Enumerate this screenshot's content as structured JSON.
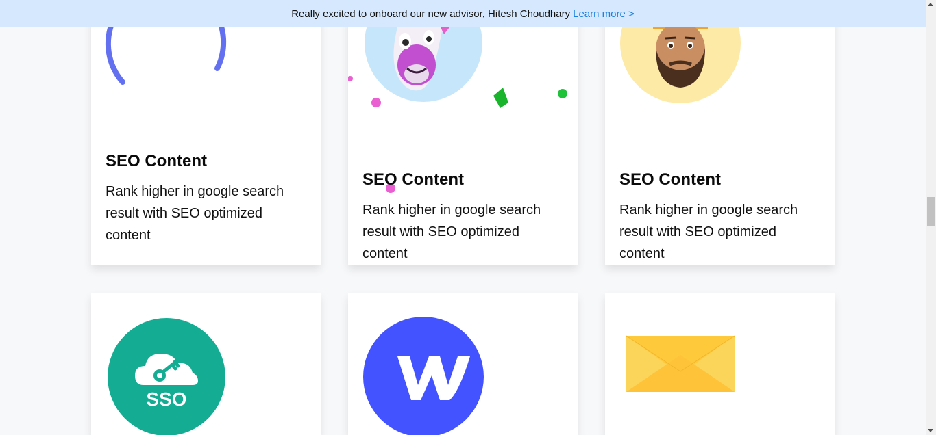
{
  "banner": {
    "text": "Really excited to onboard our new advisor, Hitesh Choudhary",
    "link_label": "Learn more >"
  },
  "cards": [
    {
      "title": "SEO Content",
      "description": "Rank higher in google search result with SEO optimized content",
      "icon": "loading-ring-icon"
    },
    {
      "title": "SEO Content",
      "description": "Rank higher in google search result with SEO optimized content",
      "icon": "unicorn-avatar-icon"
    },
    {
      "title": "SEO Content",
      "description": "Rank higher in google search result with SEO optimized content",
      "icon": "bearded-avatar-icon"
    },
    {
      "icon": "sso-cloud-key-icon",
      "icon_text": "SSO"
    },
    {
      "icon": "webflow-logo-icon"
    },
    {
      "icon": "envelope-icon"
    }
  ],
  "colors": {
    "banner_bg": "#d6e8fd",
    "link": "#1a7fe0",
    "ring": "#6371f0",
    "sso": "#14ad93",
    "webflow": "#4353ff",
    "envelope": "#ffc93c"
  }
}
